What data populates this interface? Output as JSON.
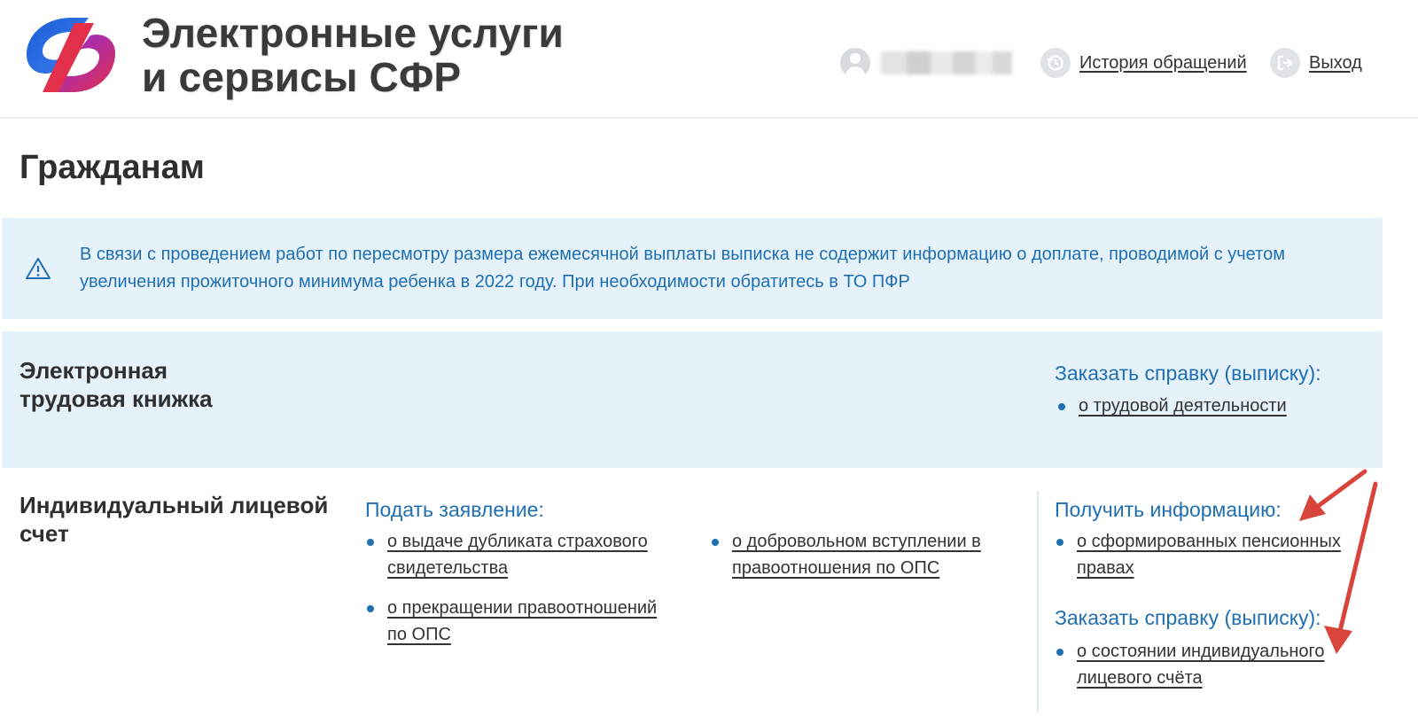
{
  "header": {
    "title_line1": "Электронные услуги",
    "title_line2": "и сервисы СФР",
    "history_label": "История обращений",
    "logout_label": "Выход",
    "history_icon": "history-icon",
    "logout_icon": "logout-icon",
    "avatar_icon": "user-avatar-icon"
  },
  "page": {
    "title": "Гражданам"
  },
  "notice": {
    "icon": "warning-icon",
    "text": "В связи с проведением работ по пересмотру размера ежемесячной выплаты выписка не содержит информацию о доплате, проводимой с учетом увеличения прожиточного минимума ребенка в 2022 году. При необходимости обратитесь в ТО ПФР"
  },
  "etk": {
    "title_line1": "Электронная",
    "title_line2": "трудовая книжка",
    "order_head": "Заказать справку (выписку):",
    "order_items": [
      "о трудовой деятельности"
    ]
  },
  "ils": {
    "title_line1": "Индивидуальный лицевой",
    "title_line2": "счет",
    "apply_head": "Подать заявление:",
    "apply_items_col1": [
      "о выдаче дубликата страхового свидетельства",
      "о прекращении правоотношений по ОПС"
    ],
    "apply_items_col2": [
      "о добровольном вступлении в правоотношения по ОПС"
    ],
    "info_head": "Получить информацию:",
    "info_items": [
      "о сформированных пенсионных правах"
    ],
    "order_head": "Заказать справку (выписку):",
    "order_items": [
      "о состоянии индивидуального лицевого счёта"
    ]
  },
  "colors": {
    "accent": "#1f6fb2",
    "notice_bg": "#e6f2fa",
    "arrow": "#d9443a",
    "logo_blue": "#1d5fd6",
    "logo_red": "#e2304a"
  }
}
